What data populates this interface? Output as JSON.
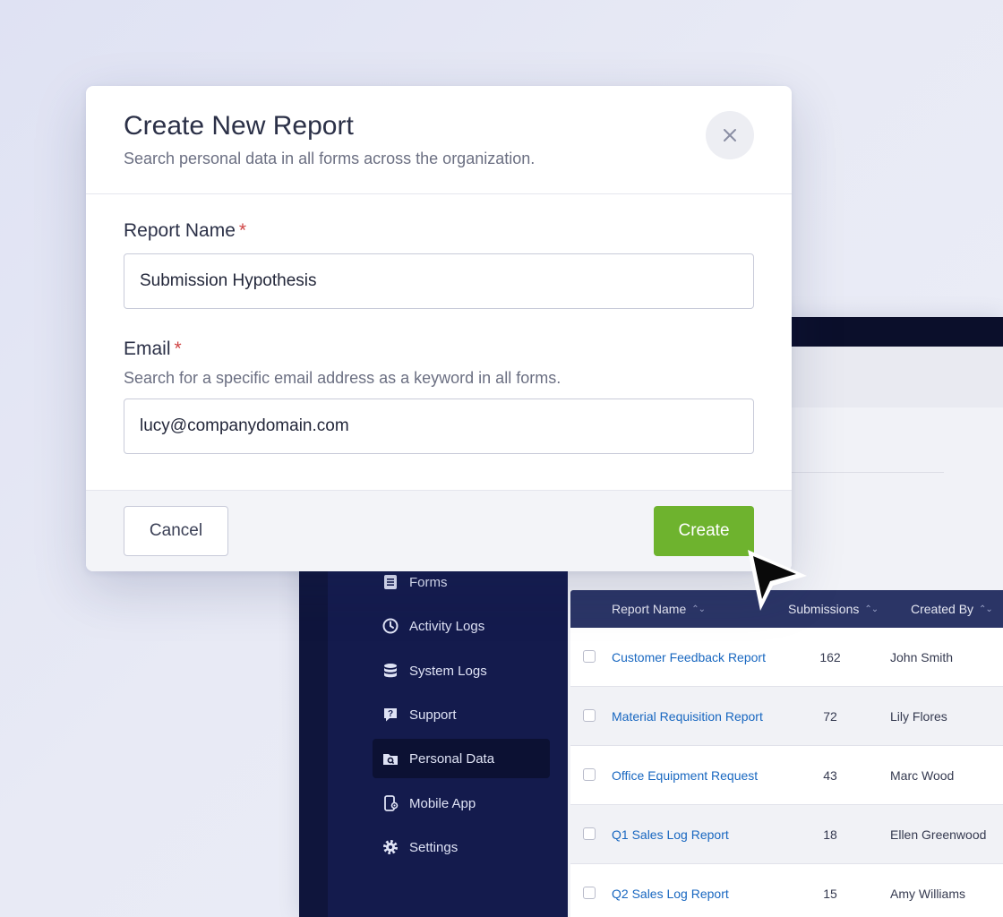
{
  "modal": {
    "title": "Create New Report",
    "subtitle": "Search personal data in all forms across the organization.",
    "close_icon": "close-icon",
    "fields": {
      "report_name": {
        "label": "Report Name",
        "required_mark": "*",
        "value": "Submission Hypothesis"
      },
      "email": {
        "label": "Email",
        "required_mark": "*",
        "helper": "Search for a specific email address as a keyword in all forms.",
        "value": "lucy@companydomain.com"
      }
    },
    "cancel_label": "Cancel",
    "create_label": "Create",
    "create_color": "#6eb32e"
  },
  "sidebar": {
    "items": [
      {
        "label": "Forms",
        "icon": "form-icon"
      },
      {
        "label": "Activity Logs",
        "icon": "clock-icon"
      },
      {
        "label": "System Logs",
        "icon": "database-icon"
      },
      {
        "label": "Support",
        "icon": "help-icon"
      },
      {
        "label": "Personal Data",
        "icon": "folder-search-icon",
        "active": true
      },
      {
        "label": "Mobile App",
        "icon": "mobile-icon"
      },
      {
        "label": "Settings",
        "icon": "gear-icon"
      }
    ]
  },
  "table": {
    "headers": [
      "Report Name",
      "Submissions",
      "Created By"
    ],
    "rows": [
      {
        "name": "Customer Feedback Report",
        "submissions": "162",
        "created_by": "John Smith"
      },
      {
        "name": "Material Requisition Report",
        "submissions": "72",
        "created_by": "Lily Flores"
      },
      {
        "name": "Office Equipment Request",
        "submissions": "43",
        "created_by": "Marc Wood"
      },
      {
        "name": "Q1 Sales Log Report",
        "submissions": "18",
        "created_by": "Ellen Greenwood"
      },
      {
        "name": "Q2 Sales Log Report",
        "submissions": "15",
        "created_by": "Amy Williams"
      }
    ]
  }
}
